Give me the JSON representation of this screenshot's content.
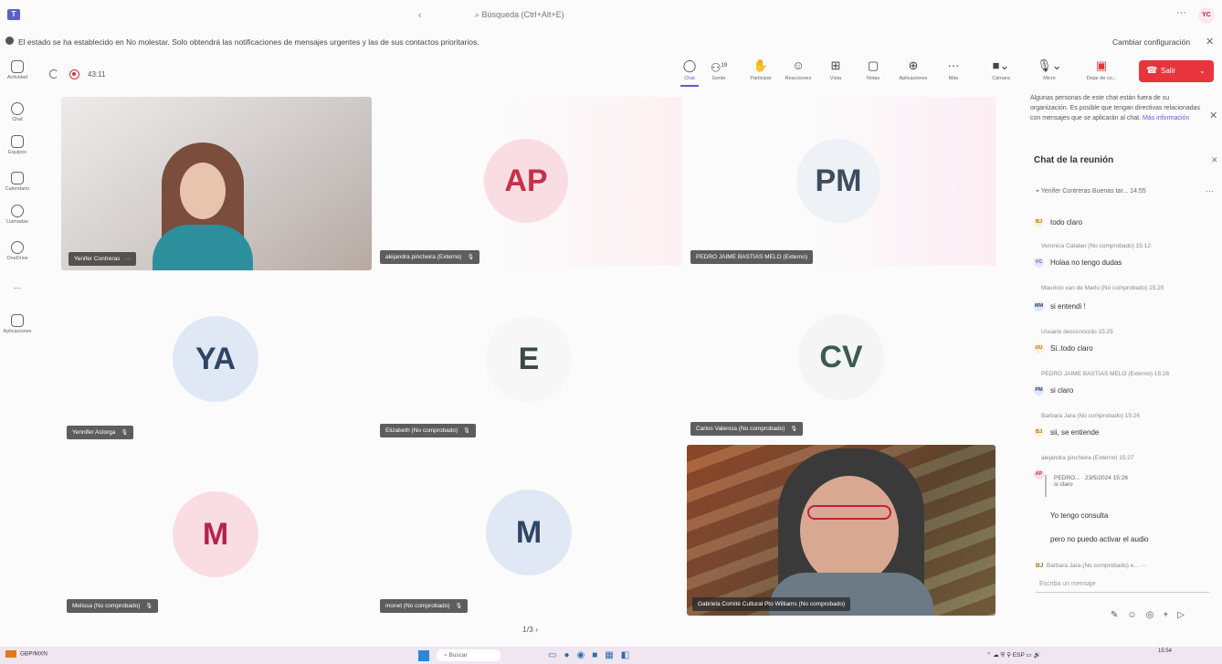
{
  "titlebar": {
    "search": "Búsqueda (Ctrl+Alt+E)",
    "avatar": "YC"
  },
  "notification": {
    "text": "El estado se ha establecido en No molestar. Solo obtendrá las notificaciones de mensajes urgentes y las de sus contactos prioritarios.",
    "link": "Cambiar configuración"
  },
  "rail": [
    {
      "label": "Actividad"
    },
    {
      "label": "Chat"
    },
    {
      "label": "Equipos"
    },
    {
      "label": "Calendario"
    },
    {
      "label": "Llamadas"
    },
    {
      "label": "OneDrive"
    },
    {
      "label": "..."
    },
    {
      "label": "Aplicaciones"
    }
  ],
  "meeting": {
    "timer": "43:11",
    "controls": [
      {
        "label": "Chat",
        "icon": "chat-icon"
      },
      {
        "label": "Gente",
        "icon": "people-icon",
        "count": "19"
      },
      {
        "label": "Participar",
        "icon": "raise-hand-icon"
      },
      {
        "label": "Reacciones",
        "icon": "emoji-icon"
      },
      {
        "label": "Vista",
        "icon": "grid-icon"
      },
      {
        "label": "Notas",
        "icon": "notes-icon"
      },
      {
        "label": "Aplicaciones",
        "icon": "add-icon"
      },
      {
        "label": "Más",
        "icon": "more-icon"
      },
      {
        "label": "Cámara",
        "icon": "camera-icon"
      },
      {
        "label": "Micro",
        "icon": "mic-icon"
      },
      {
        "label": "Dejar de co...",
        "icon": "share-icon"
      }
    ],
    "leave": "Salir"
  },
  "tiles": [
    {
      "name": "Yenifer Contreras",
      "initials": "",
      "type": "video"
    },
    {
      "name": "alejandra pincheira (Externo)",
      "initials": "AP",
      "type": "avatar",
      "color": "#c4314b",
      "bg": "#f9dde3"
    },
    {
      "name": "PEDRO JAIME BASTIAS MELO (Externo)",
      "initials": "PM",
      "type": "avatar",
      "color": "#3d4c5f",
      "bg": "#eef1f5"
    },
    {
      "name": "Yennifer Astorga",
      "initials": "YA",
      "type": "avatar",
      "color": "#2f4566",
      "bg": "#dfe8f4"
    },
    {
      "name": "Elizabeth (No comprobado)",
      "initials": "E",
      "type": "avatar",
      "color": "#3a4a4a",
      "bg": "#f7f7f7"
    },
    {
      "name": "Carlos Valencia (No comprobado)",
      "initials": "CV",
      "type": "avatar",
      "color": "#3b5b4b",
      "bg": "#f5f5f5"
    },
    {
      "name": "Melissa (No comprobado)",
      "initials": "M",
      "type": "avatar",
      "color": "#b4244c",
      "bg": "#f9dde3"
    },
    {
      "name": "monet (No comprobado)",
      "initials": "M",
      "type": "avatar",
      "color": "#2f4566",
      "bg": "#dfe8f4"
    },
    {
      "name": "Gabriela Comité Cultural Pto Williams (No comprobado)",
      "initials": "",
      "type": "video"
    }
  ],
  "pager": "1/3",
  "chat": {
    "external_note": "Algunas personas de este chat están fuera de su organización. Es posible que tengan directivas relacionadas con mensajes que se aplicarán al chat.",
    "external_link": "Más información",
    "title": "Chat de la reunión",
    "pinned": "Yenifer Contreras  Buenas tar... 14:55",
    "messages": [
      {
        "meta": "",
        "initials": "BJ",
        "text": "todo claro"
      },
      {
        "meta": "Veronica Catalan (No comprobado) 15:12",
        "initials": "VC",
        "text": "Holaa no tengo dudas"
      },
      {
        "meta": "Mauricio van de Marlo (No comprobado) 15:25",
        "initials": "MM",
        "text": "si entendi !"
      },
      {
        "meta": "Usuario desconocido 15:25",
        "initials": "UU",
        "text": "Si..todo claro"
      },
      {
        "meta": "PEDRO JAIME BASTIAS MELO (Externo) 15:26",
        "initials": "PM",
        "text": "si claro"
      },
      {
        "meta": "Barbara Jara (No comprobado) 15:26",
        "initials": "BJ",
        "text": "sii, se entiende"
      },
      {
        "meta": "alejandra pincheira (Externo) 15:27",
        "initials": "AP",
        "text": ""
      }
    ],
    "reply_author": "PEDRO...",
    "reply_time": "23/5/2024 15:26",
    "reply_text": "si claro",
    "followups": [
      "Yo tengo consulta",
      "pero no puedo activar el audio"
    ],
    "typing": "Barbara Jara (No comprobado) e...",
    "compose_placeholder": "Escriba un mensaje"
  },
  "taskbar": {
    "weather": "GBP/MXN",
    "search": "Buscar",
    "lang": "ESP",
    "time": "15:54"
  }
}
